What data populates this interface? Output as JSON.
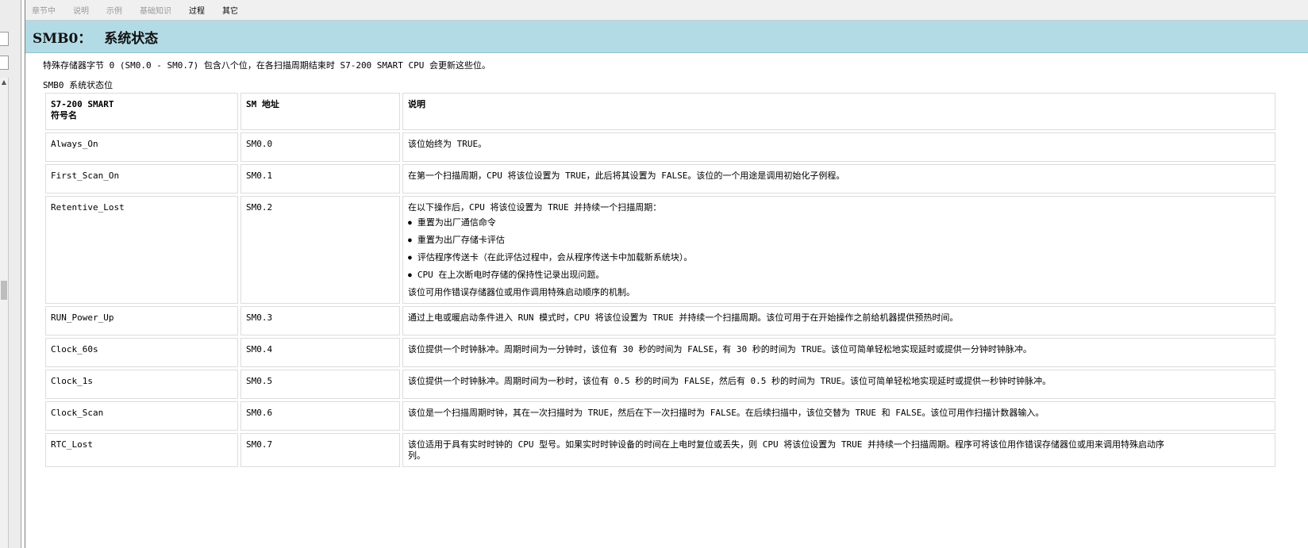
{
  "tabs": [
    {
      "label": "章节中",
      "active": false
    },
    {
      "label": "说明",
      "active": false
    },
    {
      "label": "示例",
      "active": false
    },
    {
      "label": "基础知识",
      "active": false
    },
    {
      "label": "过程",
      "active": true
    },
    {
      "label": "其它",
      "active": true
    }
  ],
  "header": {
    "code": "SMB0：",
    "title": "系统状态"
  },
  "intro": "特殊存储器字节 0 (SM0.0 - SM0.7) 包含八个位，在各扫描周期结束时 S7-200 SMART CPU 会更新这些位。",
  "table_caption": "SMB0 系统状态位",
  "table": {
    "columns": {
      "symbol_line1": "S7-200 SMART",
      "symbol_line2": "符号名",
      "address": "SM 地址",
      "description": "说明"
    },
    "rows": [
      {
        "symbol": "Always_On",
        "address": "SM0.0",
        "description": "该位始终为 TRUE。"
      },
      {
        "symbol": "First_Scan_On",
        "address": "SM0.1",
        "description": "在第一个扫描周期，CPU 将该位设置为 TRUE，此后将其设置为 FALSE。该位的一个用途是调用初始化子例程。"
      },
      {
        "symbol": "Retentive_Lost",
        "address": "SM0.2",
        "description": "在以下操作后，CPU 将该位设置为 TRUE 并持续一个扫描周期：",
        "bullets": [
          "重置为出厂通信命令",
          "重置为出厂存储卡评估",
          "评估程序传送卡（在此评估过程中，会从程序传送卡中加载新系统块）。",
          "CPU 在上次断电时存储的保持性记录出现问题。"
        ],
        "description_tail": "该位可用作错误存储器位或用作调用特殊启动顺序的机制。"
      },
      {
        "symbol": "RUN_Power_Up",
        "address": "SM0.3",
        "description": "通过上电或暖启动条件进入 RUN 模式时，CPU 将该位设置为 TRUE 并持续一个扫描周期。该位可用于在开始操作之前给机器提供预热时间。"
      },
      {
        "symbol": "Clock_60s",
        "address": "SM0.4",
        "description": "该位提供一个时钟脉冲。周期时间为一分钟时，该位有 30 秒的时间为 FALSE，有 30 秒的时间为 TRUE。该位可简单轻松地实现延时或提供一分钟时钟脉冲。"
      },
      {
        "symbol": "Clock_1s",
        "address": "SM0.5",
        "description": "该位提供一个时钟脉冲。周期时间为一秒时，该位有 0.5 秒的时间为 FALSE，然后有 0.5 秒的时间为 TRUE。该位可简单轻松地实现延时或提供一秒钟时钟脉冲。"
      },
      {
        "symbol": "Clock_Scan",
        "address": "SM0.6",
        "description": "该位是一个扫描周期时钟，其在一次扫描时为 TRUE，然后在下一次扫描时为 FALSE。在后续扫描中，该位交替为 TRUE 和 FALSE。该位可用作扫描计数器输入。"
      },
      {
        "symbol": "RTC_Lost",
        "address": "SM0.7",
        "description": "该位适用于具有实时时钟的 CPU 型号。如果实时时钟设备的时间在上电时复位或丢失，则 CPU 将该位设置为 TRUE 并持续一个扫描周期。程序可将该位用作错误存储器位或用来调用特殊启动序",
        "description_cont": "列。"
      }
    ]
  },
  "colors": {
    "header_bg": "#b3dbe6",
    "tab_inactive": "#9a9a9a",
    "cell_border": "#dcdcdc"
  }
}
